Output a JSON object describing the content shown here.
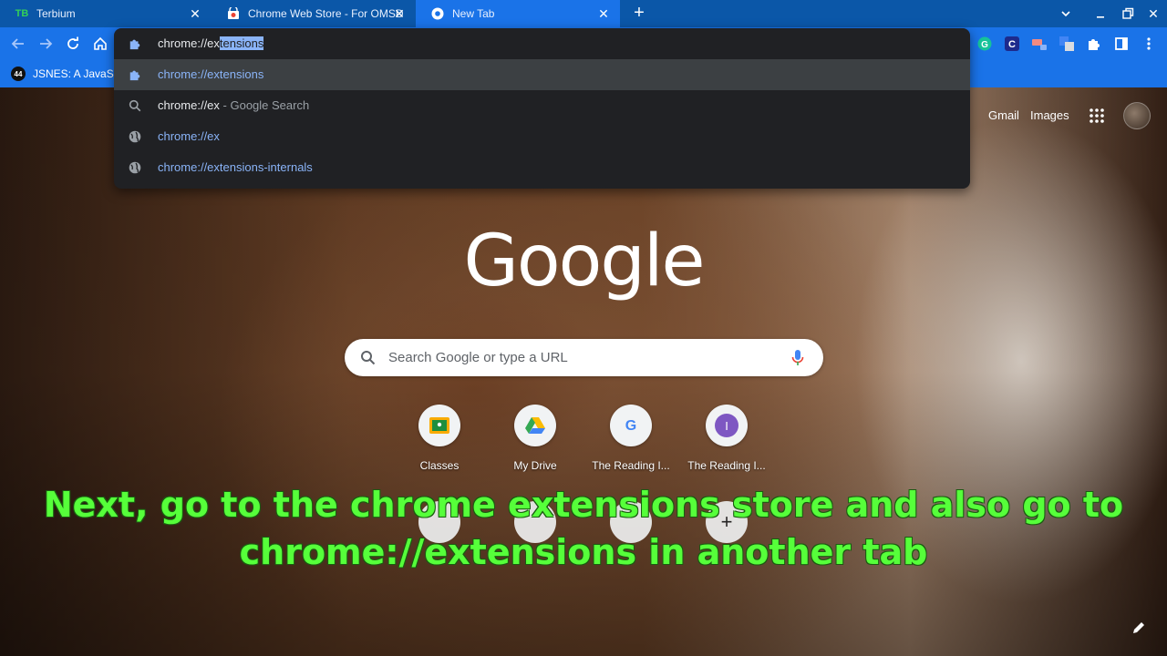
{
  "tabs": [
    {
      "title": "Terbium",
      "favicon": "TB",
      "active": false
    },
    {
      "title": "Chrome Web Store - For OMSD S",
      "active": false
    },
    {
      "title": "New Tab",
      "active": true
    }
  ],
  "omnibox": {
    "typed": "chrome://ex",
    "autocomplete": "tensions",
    "suggestions": [
      {
        "icon": "puzzle-icon",
        "match": "chrome://ex",
        "rest": "tensions",
        "suffix": ""
      },
      {
        "icon": "search-icon",
        "match": "chrome://ex",
        "rest": "",
        "suffix": " - Google Search"
      },
      {
        "icon": "globe-icon",
        "match": "chrome://ex",
        "rest": "",
        "suffix": ""
      },
      {
        "icon": "globe-icon",
        "match": "chrome://ex",
        "rest": "tensions-internals",
        "suffix": ""
      }
    ]
  },
  "bookmarks": [
    {
      "label": "JSNES: A JavaSc",
      "badge": "44"
    }
  ],
  "toolbar_extensions": [
    "grammarly-icon",
    "c-icon",
    "cast-icon",
    "translate-icon",
    "puzzle-icon",
    "sidepanel-icon",
    "menu-icon"
  ],
  "top_links": {
    "gmail": "Gmail",
    "images": "Images"
  },
  "logo_text": "Google",
  "search": {
    "placeholder": "Search Google or type a URL"
  },
  "shortcuts": [
    {
      "label": "Classes",
      "icon": "classroom-icon"
    },
    {
      "label": "My Drive",
      "icon": "drive-icon"
    },
    {
      "label": "The Reading I...",
      "icon": "google-g-icon"
    },
    {
      "label": "The Reading I...",
      "icon": "letter-i-icon",
      "letter": "I"
    }
  ],
  "caption": {
    "line1": "Next, go to the chrome extensions store and also go to",
    "line2": "chrome://extensions in another tab"
  },
  "colors": {
    "tabstrip": "#0b57a8",
    "toolbar": "#1a73e8",
    "omnibox_bg": "#202124",
    "caption": "#56ff3a"
  }
}
